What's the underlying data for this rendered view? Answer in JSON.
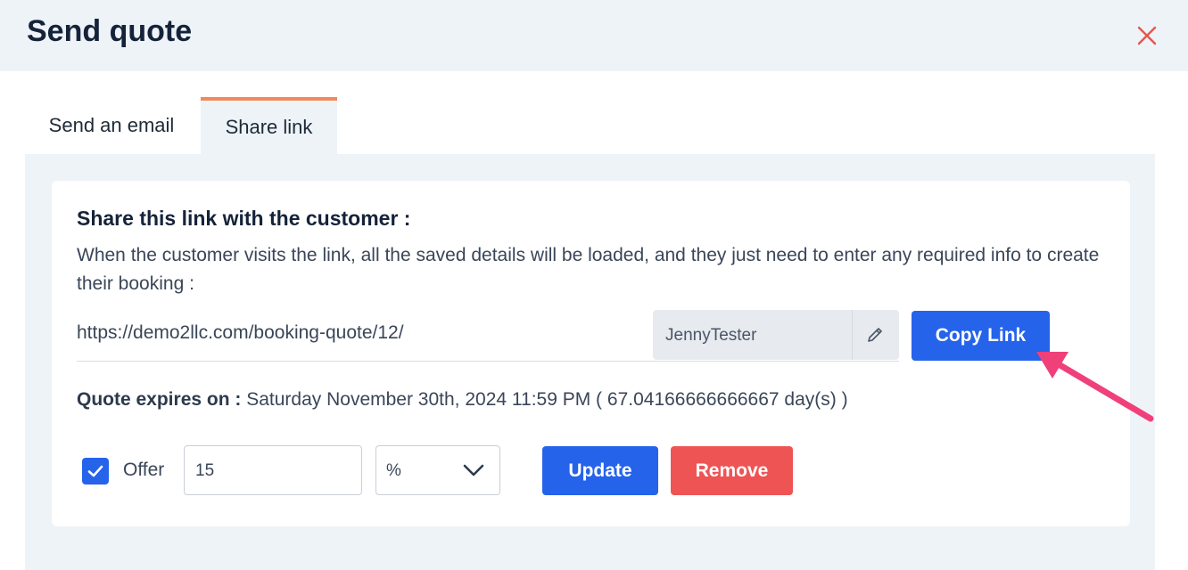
{
  "dialog": {
    "title": "Send quote"
  },
  "tabs": [
    {
      "label": "Send an email",
      "active": false
    },
    {
      "label": "Share link",
      "active": true
    }
  ],
  "share": {
    "heading": "Share this link with the customer :",
    "description": "When the customer visits the link, all the saved details will be loaded, and they just need to enter any required info to create their booking :",
    "url": "https://demo2llc.com/booking-quote/12/",
    "username": "JennyTester",
    "copy_button": "Copy Link"
  },
  "expiry": {
    "label": "Quote expires on :",
    "value": "Saturday November 30th, 2024 11:59 PM ( 67.04166666666667 day(s) )"
  },
  "offer": {
    "checked": true,
    "label": "Offer",
    "amount": "15",
    "unit": "%",
    "update_button": "Update",
    "remove_button": "Remove"
  },
  "colors": {
    "primary": "#2563eb",
    "danger": "#ef5454",
    "tab_accent": "#f2895a",
    "annotation_arrow": "#f0407a",
    "close_icon": "#e4574e"
  }
}
